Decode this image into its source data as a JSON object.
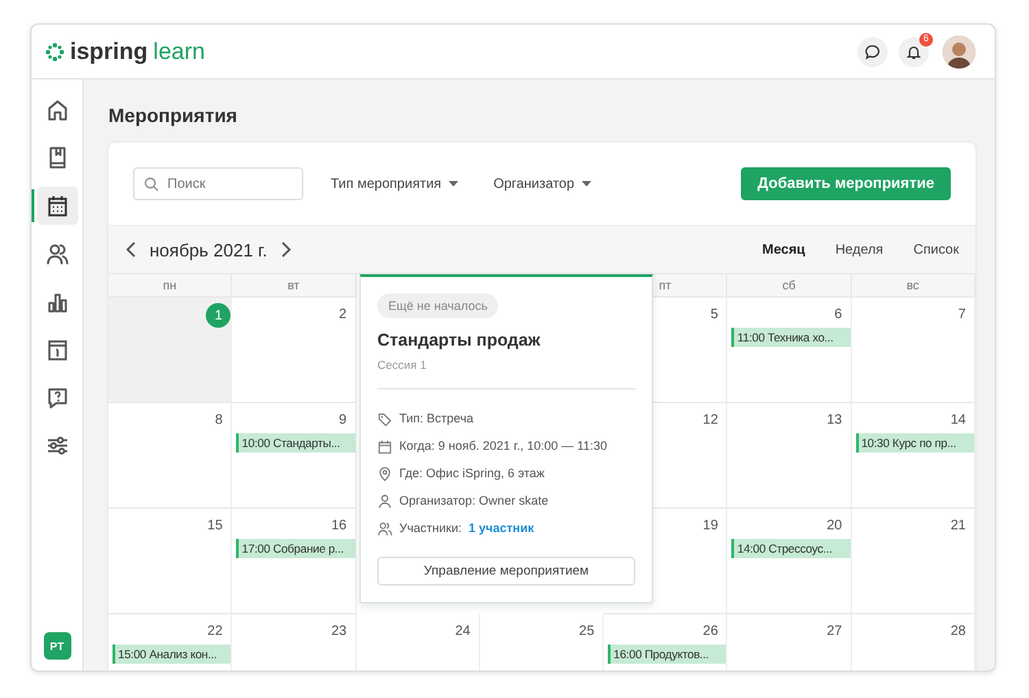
{
  "header": {
    "logo": {
      "brand": "ispring",
      "product": "learn"
    },
    "notifications": {
      "badge": "6"
    }
  },
  "sidebar": {
    "items": [
      {
        "kind": "home",
        "selected": false
      },
      {
        "kind": "book",
        "selected": false
      },
      {
        "kind": "calendar",
        "selected": true
      },
      {
        "kind": "people",
        "selected": false
      },
      {
        "kind": "chart",
        "selected": false
      },
      {
        "kind": "info",
        "selected": false
      },
      {
        "kind": "question",
        "selected": false
      },
      {
        "kind": "sliders",
        "selected": false
      }
    ],
    "user_initials": "PT"
  },
  "page": {
    "title": "Мероприятия"
  },
  "toolbar": {
    "search": {
      "placeholder": "Поиск"
    },
    "filters": [
      "Тип мероприятия",
      "Организатор"
    ],
    "add_button": "Добавить мероприятие"
  },
  "calendar": {
    "month": "ноябрь 2021 г.",
    "views": [
      {
        "label": "Месяц",
        "selected": true
      },
      {
        "label": "Неделя",
        "selected": false
      },
      {
        "label": "Список",
        "selected": false
      }
    ],
    "weekdays": [
      {
        "label": "пн"
      },
      {
        "label": "вт"
      },
      {
        "label": "пт"
      },
      {
        "label": "сб"
      },
      {
        "label": "вс"
      }
    ],
    "weeks": [
      [
        {
          "day": "1",
          "today": true
        },
        {
          "day": "2",
          "today": false
        },
        {
          "day": "5",
          "today": false
        },
        {
          "day": "6",
          "today": false,
          "events": [
            "11:00 Техника хо..."
          ]
        },
        {
          "day": "7",
          "today": false
        }
      ],
      [
        {
          "day": "8",
          "today": false
        },
        {
          "day": "9",
          "today": false,
          "events": [
            "10:00 Стандарты..."
          ]
        },
        {
          "day": "12",
          "today": false
        },
        {
          "day": "13",
          "today": false
        },
        {
          "day": "14",
          "today": false,
          "events": [
            "10:30 Курс по пр..."
          ]
        }
      ],
      [
        {
          "day": "15",
          "today": false
        },
        {
          "day": "16",
          "today": false,
          "events": [
            "17:00 Собрание р..."
          ]
        },
        {
          "day": "19",
          "today": false
        },
        {
          "day": "20",
          "today": false,
          "events": [
            "14:00 Стрессоус..."
          ]
        },
        {
          "day": "21",
          "today": false
        }
      ],
      [
        {
          "day": "22",
          "today": false,
          "events": [
            "15:00 Анализ кон..."
          ]
        },
        {
          "day": "23",
          "today": false
        },
        {
          "day": "24",
          "today": false
        },
        {
          "day": "25",
          "today": false
        },
        {
          "day": "26",
          "today": false,
          "events": [
            "16:00 Продуктов..."
          ]
        },
        {
          "day": "27",
          "today": false
        },
        {
          "day": "28",
          "today": false
        }
      ]
    ],
    "popup": {
      "status": "Ещё не началось",
      "title": "Стандарты продаж",
      "subtitle": "Сессия 1",
      "details": [
        {
          "kind": "type",
          "text": "Тип: Встреча"
        },
        {
          "kind": "when",
          "text": "Когда: 9 нояб. 2021 г., 10:00 — 11:30"
        },
        {
          "kind": "where",
          "text": "Где: Офис iSpring, 6 этаж"
        },
        {
          "kind": "organizer",
          "text": "Организатор: Owner skate"
        },
        {
          "kind": "participants",
          "text": "Участники:",
          "link": "1 участник"
        }
      ],
      "button": "Управление мероприятием"
    }
  }
}
